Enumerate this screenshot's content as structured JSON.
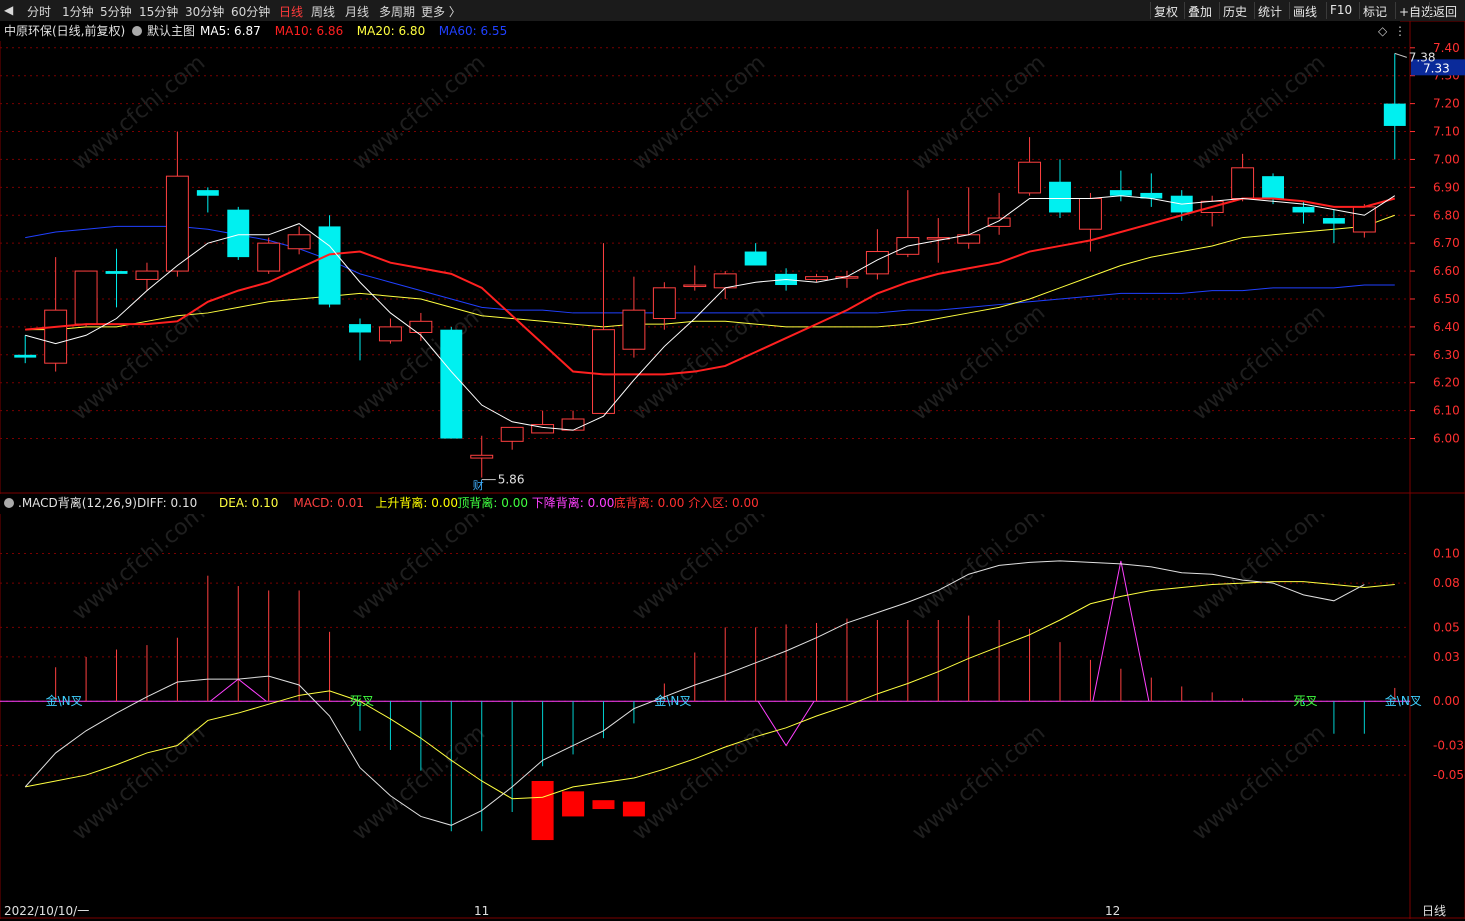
{
  "toolbar": {
    "left_items": [
      "分时",
      "1分钟",
      "5分钟",
      "15分钟",
      "30分钟",
      "60分钟",
      "日线",
      "周线",
      "月线",
      "多周期",
      "更多 〉"
    ],
    "active_item": "日线",
    "right_items": [
      "复权",
      "叠加",
      "历史",
      "统计",
      "画线",
      "F10",
      "标记",
      "+自选",
      "返回"
    ]
  },
  "main_panel": {
    "title": "中原环保(日线,前复权)",
    "indicator_name": "默认主图",
    "ma": [
      {
        "label": "MA5: 6.87",
        "color": "#ffffff"
      },
      {
        "label": "MA10: 6.86",
        "color": "#ff2020"
      },
      {
        "label": "MA20: 6.80",
        "color": "#ffff40"
      },
      {
        "label": "MA60: 6.55",
        "color": "#2040ff"
      }
    ],
    "price_axis": [
      "7.40",
      "7.30",
      "7.20",
      "7.10",
      "7.00",
      "6.90",
      "6.80",
      "6.70",
      "6.60",
      "6.50",
      "6.40",
      "6.30",
      "6.20",
      "6.10",
      "6.00"
    ],
    "current_price": "7.33",
    "high_marker": "7.38",
    "low_marker": "5.86",
    "finance_marker": "财"
  },
  "macd_panel": {
    "title": ".MACD背离(12,26,9)",
    "fields": [
      {
        "label": "DIFF: 0.10",
        "color": "#e0e0e0"
      },
      {
        "label": "DEA: 0.10",
        "color": "#ffff40"
      },
      {
        "label": "MACD: 0.01",
        "color": "#ff4040"
      },
      {
        "label": "上升背离: 0.00",
        "color": "#ffff00"
      },
      {
        "label": "顶背离: 0.00",
        "color": "#40ff40"
      },
      {
        "label": "下降背离: 0.00",
        "color": "#ff40ff"
      },
      {
        "label": "底背离: 0.00",
        "color": "#ff3030"
      },
      {
        "label": "介入区: 0.00",
        "color": "#ff3030"
      }
    ],
    "axis": [
      "0.10",
      "0.08",
      "0.05",
      "0.03",
      "0.00",
      "-0.03",
      "-0.05"
    ],
    "signals": [
      "金\\N叉",
      "死叉",
      "金\\N叉",
      "死叉",
      "金\\N叉"
    ]
  },
  "time_axis": {
    "start": "2022/10/10/一",
    "labels": [
      "11",
      "12"
    ]
  },
  "period_label": "日线",
  "watermark": "www.cfchi.com",
  "colors": {
    "up": "#ff4040",
    "down": "#00f0f0",
    "ma5": "#ffffff",
    "ma10": "#ff2020",
    "ma20": "#ffff40",
    "ma60": "#2040ff",
    "grid": "#7a0000"
  },
  "chart_data": {
    "type": "candlestick",
    "dates_start": "2022/10/10",
    "candles": [
      {
        "o": 6.3,
        "c": 6.29,
        "h": 6.37,
        "l": 6.27
      },
      {
        "o": 6.27,
        "c": 6.46,
        "h": 6.65,
        "l": 6.24
      },
      {
        "o": 6.41,
        "c": 6.6,
        "h": 6.6,
        "l": 6.4
      },
      {
        "o": 6.6,
        "c": 6.59,
        "h": 6.68,
        "l": 6.47
      },
      {
        "o": 6.57,
        "c": 6.6,
        "h": 6.63,
        "l": 6.53
      },
      {
        "o": 6.6,
        "c": 6.94,
        "h": 7.1,
        "l": 6.58
      },
      {
        "o": 6.89,
        "c": 6.87,
        "h": 6.9,
        "l": 6.81
      },
      {
        "o": 6.82,
        "c": 6.65,
        "h": 6.83,
        "l": 6.64
      },
      {
        "o": 6.6,
        "c": 6.7,
        "h": 6.72,
        "l": 6.59
      },
      {
        "o": 6.68,
        "c": 6.73,
        "h": 6.76,
        "l": 6.66
      },
      {
        "o": 6.76,
        "c": 6.48,
        "h": 6.8,
        "l": 6.47
      },
      {
        "o": 6.41,
        "c": 6.38,
        "h": 6.43,
        "l": 6.28
      },
      {
        "o": 6.35,
        "c": 6.4,
        "h": 6.43,
        "l": 6.34
      },
      {
        "o": 6.38,
        "c": 6.42,
        "h": 6.45,
        "l": 6.35
      },
      {
        "o": 6.39,
        "c": 6.0,
        "h": 6.4,
        "l": 6.0
      },
      {
        "o": 5.93,
        "c": 5.94,
        "h": 6.01,
        "l": 5.86
      },
      {
        "o": 5.99,
        "c": 6.04,
        "h": 6.04,
        "l": 5.96
      },
      {
        "o": 6.02,
        "c": 6.05,
        "h": 6.1,
        "l": 6.02
      },
      {
        "o": 6.03,
        "c": 6.07,
        "h": 6.1,
        "l": 6.03
      },
      {
        "o": 6.09,
        "c": 6.39,
        "h": 6.7,
        "l": 6.09
      },
      {
        "o": 6.32,
        "c": 6.46,
        "h": 6.58,
        "l": 6.29
      },
      {
        "o": 6.43,
        "c": 6.54,
        "h": 6.56,
        "l": 6.39
      },
      {
        "o": 6.55,
        "c": 6.55,
        "h": 6.62,
        "l": 6.53
      },
      {
        "o": 6.54,
        "c": 6.59,
        "h": 6.6,
        "l": 6.5
      },
      {
        "o": 6.67,
        "c": 6.62,
        "h": 6.7,
        "l": 6.62
      },
      {
        "o": 6.59,
        "c": 6.55,
        "h": 6.61,
        "l": 6.53
      },
      {
        "o": 6.57,
        "c": 6.58,
        "h": 6.59,
        "l": 6.56
      },
      {
        "o": 6.58,
        "c": 6.58,
        "h": 6.6,
        "l": 6.54
      },
      {
        "o": 6.59,
        "c": 6.67,
        "h": 6.75,
        "l": 6.57
      },
      {
        "o": 6.66,
        "c": 6.72,
        "h": 6.89,
        "l": 6.65
      },
      {
        "o": 6.72,
        "c": 6.72,
        "h": 6.79,
        "l": 6.63
      },
      {
        "o": 6.7,
        "c": 6.73,
        "h": 6.9,
        "l": 6.68
      },
      {
        "o": 6.76,
        "c": 6.79,
        "h": 6.88,
        "l": 6.73
      },
      {
        "o": 6.88,
        "c": 6.99,
        "h": 7.08,
        "l": 6.87
      },
      {
        "o": 6.92,
        "c": 6.81,
        "h": 7.0,
        "l": 6.79
      },
      {
        "o": 6.75,
        "c": 6.86,
        "h": 6.88,
        "l": 6.67
      },
      {
        "o": 6.89,
        "c": 6.87,
        "h": 6.96,
        "l": 6.85
      },
      {
        "o": 6.88,
        "c": 6.86,
        "h": 6.95,
        "l": 6.83
      },
      {
        "o": 6.87,
        "c": 6.81,
        "h": 6.89,
        "l": 6.78
      },
      {
        "o": 6.81,
        "c": 6.85,
        "h": 6.87,
        "l": 6.76
      },
      {
        "o": 6.86,
        "c": 6.97,
        "h": 7.02,
        "l": 6.85
      },
      {
        "o": 6.94,
        "c": 6.86,
        "h": 6.95,
        "l": 6.84
      },
      {
        "o": 6.83,
        "c": 6.81,
        "h": 6.85,
        "l": 6.77
      },
      {
        "o": 6.79,
        "c": 6.77,
        "h": 6.82,
        "l": 6.7
      },
      {
        "o": 6.74,
        "c": 6.83,
        "h": 6.84,
        "l": 6.72
      },
      {
        "o": 7.2,
        "c": 7.12,
        "h": 7.38,
        "l": 7.0
      }
    ],
    "ma5": [
      6.37,
      6.34,
      6.37,
      6.43,
      6.53,
      6.62,
      6.7,
      6.73,
      6.73,
      6.77,
      6.69,
      6.56,
      6.45,
      6.37,
      6.24,
      6.12,
      6.06,
      6.04,
      6.03,
      6.08,
      6.21,
      6.33,
      6.43,
      6.54,
      6.56,
      6.57,
      6.56,
      6.58,
      6.64,
      6.69,
      6.71,
      6.73,
      6.78,
      6.86,
      6.86,
      6.86,
      6.87,
      6.86,
      6.84,
      6.85,
      6.86,
      6.85,
      6.84,
      6.82,
      6.8,
      6.87
    ],
    "ma10": [
      6.39,
      6.4,
      6.41,
      6.41,
      6.41,
      6.42,
      6.49,
      6.53,
      6.56,
      6.61,
      6.66,
      6.67,
      6.63,
      6.61,
      6.59,
      6.54,
      6.44,
      6.34,
      6.24,
      6.23,
      6.23,
      6.23,
      6.24,
      6.26,
      6.31,
      6.36,
      6.41,
      6.46,
      6.52,
      6.56,
      6.59,
      6.61,
      6.63,
      6.67,
      6.69,
      6.71,
      6.74,
      6.77,
      6.8,
      6.83,
      6.86,
      6.86,
      6.85,
      6.83,
      6.83,
      6.86
    ],
    "ma20": [
      6.39,
      6.39,
      6.4,
      6.4,
      6.42,
      6.44,
      6.45,
      6.47,
      6.49,
      6.5,
      6.51,
      6.52,
      6.51,
      6.5,
      6.47,
      6.44,
      6.43,
      6.42,
      6.41,
      6.4,
      6.41,
      6.41,
      6.42,
      6.42,
      6.41,
      6.4,
      6.4,
      6.4,
      6.4,
      6.41,
      6.43,
      6.45,
      6.47,
      6.5,
      6.54,
      6.58,
      6.62,
      6.65,
      6.67,
      6.69,
      6.72,
      6.73,
      6.74,
      6.75,
      6.76,
      6.8
    ],
    "ma60": [
      6.72,
      6.74,
      6.75,
      6.76,
      6.76,
      6.76,
      6.75,
      6.73,
      6.71,
      6.68,
      6.64,
      6.59,
      6.56,
      6.53,
      6.5,
      6.47,
      6.46,
      6.46,
      6.45,
      6.45,
      6.45,
      6.45,
      6.45,
      6.45,
      6.45,
      6.45,
      6.45,
      6.45,
      6.45,
      6.46,
      6.46,
      6.47,
      6.48,
      6.49,
      6.5,
      6.51,
      6.52,
      6.52,
      6.52,
      6.53,
      6.53,
      6.54,
      6.54,
      6.54,
      6.55,
      6.55
    ],
    "macd_panel": {
      "diff": [
        -0.058,
        -0.035,
        -0.02,
        -0.008,
        0.003,
        0.013,
        0.015,
        0.015,
        0.017,
        0.011,
        -0.01,
        -0.045,
        -0.064,
        -0.078,
        -0.084,
        -0.074,
        -0.058,
        -0.04,
        -0.03,
        -0.02,
        -0.005,
        0.003,
        0.011,
        0.018,
        0.026,
        0.034,
        0.043,
        0.053,
        0.06,
        0.067,
        0.075,
        0.086,
        0.092,
        0.094,
        0.095,
        0.094,
        0.093,
        0.091,
        0.087,
        0.086,
        0.082,
        0.08,
        0.072,
        0.068,
        0.079
      ],
      "dea": [
        -0.058,
        -0.054,
        -0.05,
        -0.043,
        -0.035,
        -0.03,
        -0.013,
        -0.008,
        -0.002,
        0.004,
        0.007,
        0.0,
        -0.012,
        -0.025,
        -0.04,
        -0.054,
        -0.066,
        -0.065,
        -0.058,
        -0.055,
        -0.052,
        -0.046,
        -0.039,
        -0.031,
        -0.024,
        -0.018,
        -0.01,
        -0.003,
        0.005,
        0.012,
        0.02,
        0.029,
        0.037,
        0.045,
        0.055,
        0.066,
        0.071,
        0.075,
        0.077,
        0.079,
        0.08,
        0.081,
        0.081,
        0.079,
        0.077,
        0.079
      ],
      "hist": [
        0.0,
        0.023,
        0.03,
        0.035,
        0.038,
        0.043,
        0.085,
        0.078,
        0.075,
        0.075,
        0.047,
        -0.02,
        -0.033,
        -0.047,
        -0.088,
        -0.088,
        -0.075,
        -0.044,
        -0.036,
        -0.025,
        -0.015,
        0.012,
        0.033,
        0.05,
        0.05,
        0.052,
        0.053,
        0.056,
        0.055,
        0.055,
        0.055,
        0.058,
        0.055,
        0.049,
        0.04,
        0.028,
        0.022,
        0.016,
        0.01,
        0.006,
        0.002,
        0.0,
        -0.002,
        -0.022,
        -0.022,
        0.009
      ],
      "ylim": [
        -0.14,
        0.12
      ]
    }
  }
}
